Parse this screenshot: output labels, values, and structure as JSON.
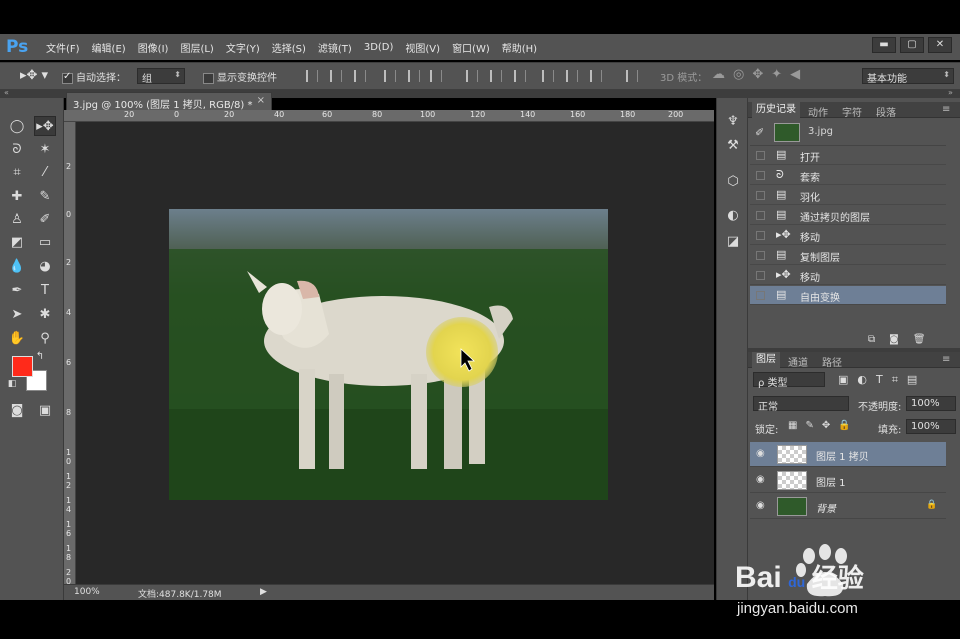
{
  "app": {
    "logo": "Ps"
  },
  "menu": [
    "文件(F)",
    "编辑(E)",
    "图像(I)",
    "图层(L)",
    "文字(Y)",
    "选择(S)",
    "滤镜(T)",
    "3D(D)",
    "视图(V)",
    "窗口(W)",
    "帮助(H)"
  ],
  "window_controls": {
    "minimize": "▬",
    "restore": "▢",
    "close": "✕"
  },
  "options": {
    "auto_select_label": "自动选择：",
    "auto_select_checked": true,
    "auto_select_value": "组",
    "show_transform_label": "显示变换控件",
    "show_transform_checked": false,
    "mode_3d_label": "3D 模式：",
    "workspace": "基本功能"
  },
  "document": {
    "tab_title": "3.jpg @ 100% (图层 1 拷贝, RGB/8) *",
    "close": "×",
    "zoom": "100%",
    "doc_info": "文档:487.8K/1.78M",
    "ruler_top": [
      "20",
      "0",
      "20",
      "40",
      "60",
      "80",
      "100",
      "120",
      "140",
      "160",
      "180",
      "200"
    ],
    "ruler_left": [
      "2",
      "0",
      "2",
      "4",
      "6",
      "8",
      "1 0",
      "1 2",
      "1 4",
      "1 6",
      "1 8",
      "2 0"
    ]
  },
  "colors": {
    "foreground": "#ff2a1a",
    "background": "#ffffff",
    "selection": "#6e7f96"
  },
  "history": {
    "tabs": [
      "历史记录",
      "动作",
      "字符",
      "段落"
    ],
    "snapshot": "3.jpg",
    "items": [
      {
        "label": "打开",
        "icon": "document-icon"
      },
      {
        "label": "套索",
        "icon": "lasso-icon"
      },
      {
        "label": "羽化",
        "icon": "document-icon"
      },
      {
        "label": "通过拷贝的图层",
        "icon": "document-icon"
      },
      {
        "label": "移动",
        "icon": "move-icon"
      },
      {
        "label": "复制图层",
        "icon": "document-icon"
      },
      {
        "label": "移动",
        "icon": "move-icon"
      },
      {
        "label": "自由变换",
        "icon": "document-icon",
        "selected": true
      }
    ]
  },
  "layers": {
    "tabs": [
      "图层",
      "通道",
      "路径"
    ],
    "filter_type": "ρ 类型",
    "blend_mode": "正常",
    "opacity_label": "不透明度:",
    "opacity_value": "100%",
    "lock_label": "锁定:",
    "fill_label": "填充:",
    "fill_value": "100%",
    "items": [
      {
        "name": "图层 1 拷贝",
        "selected": true
      },
      {
        "name": "图层 1",
        "selected": false
      },
      {
        "name": "背景",
        "selected": false,
        "locked": true
      }
    ]
  },
  "watermark": {
    "brand_a": "Bai",
    "brand_b": "du",
    "brand_c": "经验",
    "url": "jingyan.baidu.com"
  }
}
